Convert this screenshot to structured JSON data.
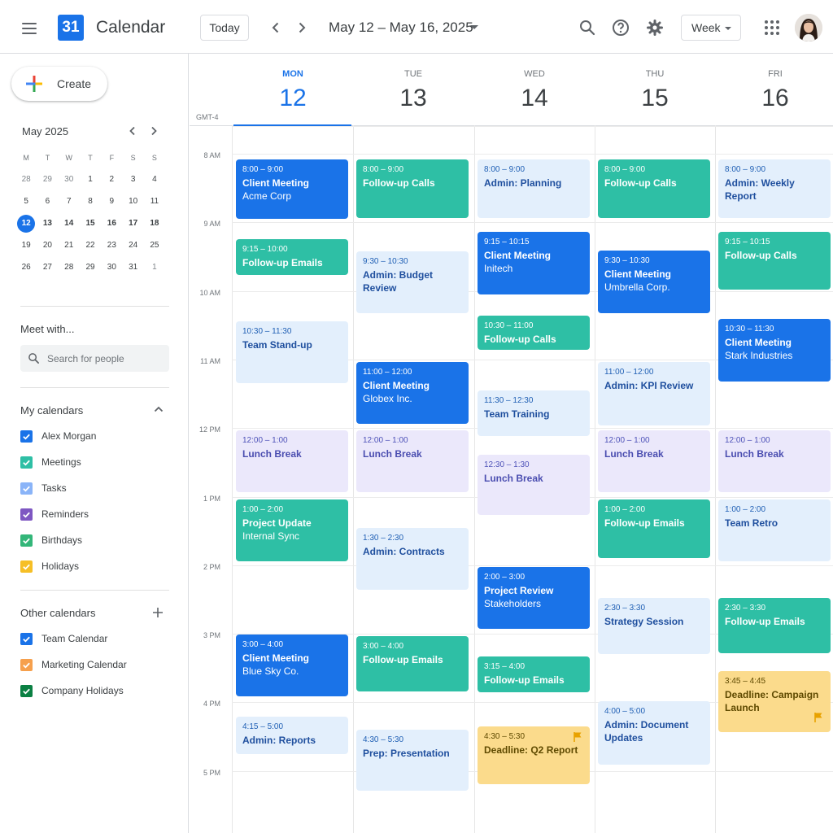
{
  "header": {
    "app_logo_day": "31",
    "app_title": "Calendar",
    "today_label": "Today",
    "date_range": "May 12 – May 16, 2025",
    "view_label": "Week"
  },
  "sidebar": {
    "create_label": "Create",
    "mini_calendar": {
      "title": "May 2025",
      "weekday_heads": [
        "M",
        "T",
        "W",
        "T",
        "F",
        "S",
        "S"
      ],
      "weeks": [
        [
          "28",
          "29",
          "30",
          "1",
          "2",
          "3",
          "4"
        ],
        [
          "5",
          "6",
          "7",
          "8",
          "9",
          "10",
          "11"
        ],
        [
          "12",
          "13",
          "14",
          "15",
          "16",
          "17",
          "18"
        ],
        [
          "19",
          "20",
          "21",
          "22",
          "23",
          "24",
          "25"
        ],
        [
          "26",
          "27",
          "28",
          "29",
          "30",
          "31",
          "1"
        ]
      ],
      "today": "12"
    },
    "meet_with": {
      "title": "Meet with...",
      "search_placeholder": "Search for people"
    },
    "my_calendars": {
      "title": "My calendars",
      "items": [
        {
          "label": "Alex Morgan",
          "color": "#1a73e8"
        },
        {
          "label": "Meetings",
          "color": "#2ebfa5"
        },
        {
          "label": "Tasks",
          "color": "#8ab4f8"
        },
        {
          "label": "Reminders",
          "color": "#7e57c2"
        },
        {
          "label": "Birthdays",
          "color": "#33b679"
        },
        {
          "label": "Holidays",
          "color": "#f6bf26"
        }
      ]
    },
    "other_calendars": {
      "title": "Other calendars",
      "items": [
        {
          "label": "Team Calendar",
          "color": "#1a73e8"
        },
        {
          "label": "Marketing Calendar",
          "color": "#f6a04d"
        },
        {
          "label": "Company Holidays",
          "color": "#0b8043"
        }
      ]
    }
  },
  "week": {
    "timezone": "GMT-4",
    "days": [
      {
        "name": "MON",
        "num": "12",
        "active": true
      },
      {
        "name": "TUE",
        "num": "13",
        "active": false
      },
      {
        "name": "WED",
        "num": "14",
        "active": false
      },
      {
        "name": "THU",
        "num": "15",
        "active": false
      },
      {
        "name": "FRI",
        "num": "16",
        "active": false
      }
    ],
    "hours": [
      "8 AM",
      "9 AM",
      "10 AM",
      "11 AM",
      "12 PM",
      "1 PM",
      "2 PM",
      "3 PM",
      "4 PM",
      "5 PM",
      "6 PM"
    ]
  },
  "events": {
    "mon": [
      {
        "time": "8:00 – 9:00",
        "title": "Client Meeting",
        "sub": "Acme Corp"
      },
      {
        "time": "9:15 – 10:00",
        "title": "Follow-up Emails"
      },
      {
        "time": "10:30 – 11:30",
        "title": "Team Stand-up"
      },
      {
        "time": "12:00 – 1:00",
        "title": "Lunch Break"
      },
      {
        "time": "1:00 – 2:00",
        "title": "Project Update",
        "sub": "Internal Sync"
      },
      {
        "time": "3:00 – 4:00",
        "title": "Client Meeting",
        "sub": "Blue Sky Co."
      },
      {
        "time": "4:15 – 5:00",
        "title": "Admin: Reports"
      }
    ],
    "tue": [
      {
        "time": "8:00 – 9:00",
        "title": "Follow-up Calls"
      },
      {
        "time": "9:30 – 10:30",
        "title": "Admin: Budget Review"
      },
      {
        "time": "11:00 – 12:00",
        "title": "Client Meeting",
        "sub": "Globex Inc."
      },
      {
        "time": "12:00 – 1:00",
        "title": "Lunch Break"
      },
      {
        "time": "1:30 – 2:30",
        "title": "Admin: Contracts"
      },
      {
        "time": "3:00 – 4:00",
        "title": "Follow-up Emails"
      },
      {
        "time": "4:30 – 5:30",
        "title": "Prep: Presentation"
      }
    ],
    "wed": [
      {
        "time": "8:00 – 9:00",
        "title": "Admin: Planning"
      },
      {
        "time": "9:15 – 10:15",
        "title": "Client Meeting",
        "sub": "Initech"
      },
      {
        "time": "10:30 – 11:00",
        "title": "Follow-up Calls"
      },
      {
        "time": "11:30 – 12:30",
        "title": "Team Training"
      },
      {
        "time": "12:30 – 1:30",
        "title": "Lunch Break"
      },
      {
        "time": "2:00 – 3:00",
        "title": "Project Review",
        "sub": "Stakeholders"
      },
      {
        "time": "3:15 – 4:00",
        "title": "Follow-up Emails"
      },
      {
        "time": "4:30 – 5:30",
        "title": "Deadline: Q2 Report"
      }
    ],
    "thu": [
      {
        "time": "8:00 – 9:00",
        "title": "Follow-up Calls"
      },
      {
        "time": "9:30 – 10:30",
        "title": "Client Meeting",
        "sub": "Umbrella Corp."
      },
      {
        "time": "11:00 – 12:00",
        "title": "Admin: KPI Review"
      },
      {
        "time": "12:00 – 1:00",
        "title": "Lunch Break"
      },
      {
        "time": "1:00 – 2:00",
        "title": "Follow-up Emails"
      },
      {
        "time": "2:30 – 3:30",
        "title": "Strategy Session"
      },
      {
        "time": "4:00 – 5:00",
        "title": "Admin: Document Updates"
      }
    ],
    "fri": [
      {
        "time": "8:00 – 9:00",
        "title": "Admin: Weekly Report"
      },
      {
        "time": "9:15 – 10:15",
        "title": "Follow-up Calls"
      },
      {
        "time": "10:30 – 11:30",
        "title": "Client Meeting",
        "sub": "Stark Industries"
      },
      {
        "time": "12:00 – 1:00",
        "title": "Lunch Break"
      },
      {
        "time": "1:00 – 2:00",
        "title": "Team Retro"
      },
      {
        "time": "2:30 – 3:30",
        "title": "Follow-up Emails"
      },
      {
        "time": "3:45 – 4:45",
        "title": "Deadline: Campaign Launch"
      }
    ]
  }
}
